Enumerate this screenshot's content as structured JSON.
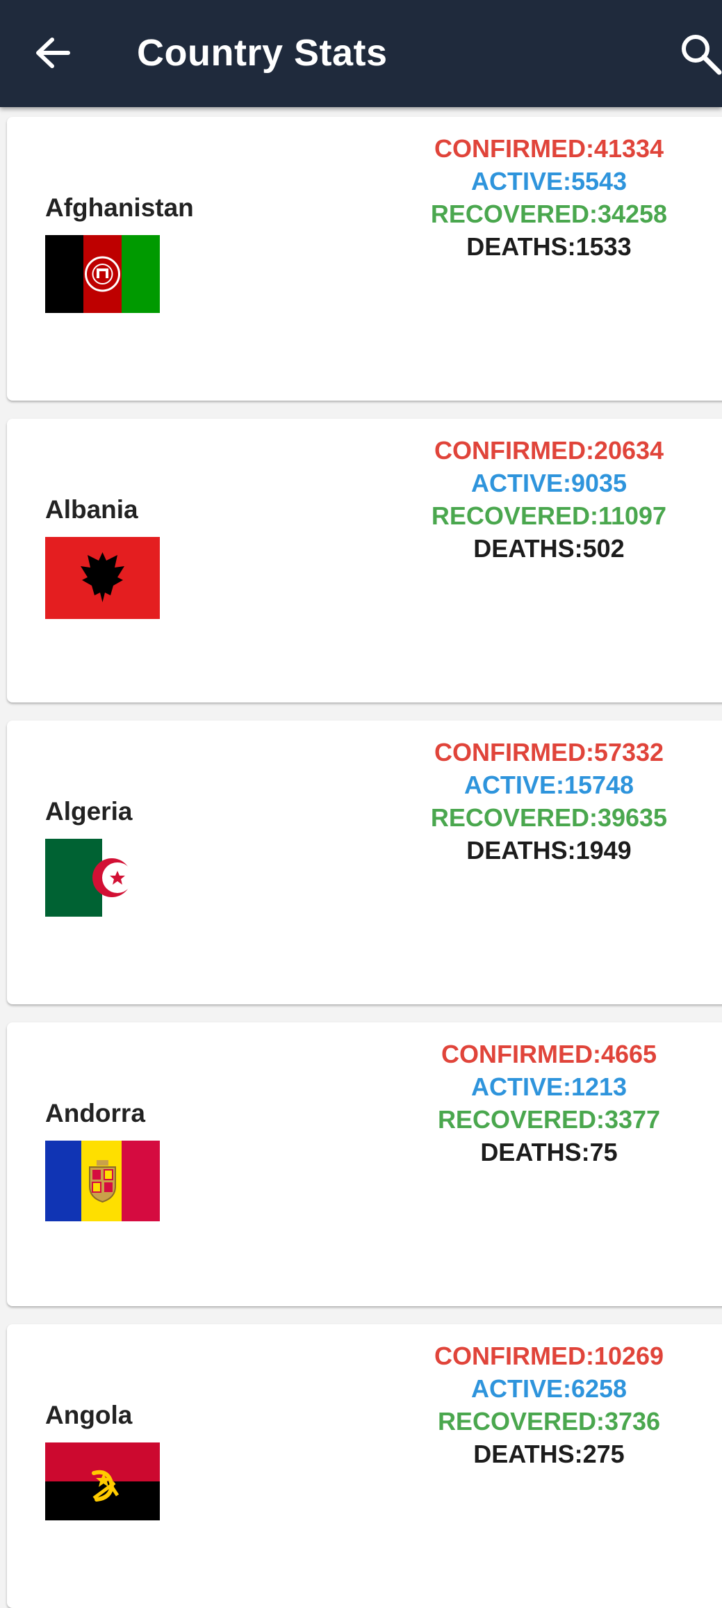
{
  "appbar": {
    "title": "Country Stats",
    "back_icon": "arrow-left-icon",
    "search_icon": "search-icon",
    "background": "#1f2a3c"
  },
  "colors": {
    "confirmed": "#e0443a",
    "active": "#2e94dc",
    "recovered": "#4aa74e",
    "deaths": "#1c1c1c"
  },
  "countries": [
    {
      "name": "Afghanistan",
      "flag": "afghanistan-flag-icon",
      "confirmed": "CONFIRMED:41334",
      "active": "ACTIVE:5543",
      "recovered": "RECOVERED:34258",
      "deaths": "DEATHS:1533"
    },
    {
      "name": "Albania",
      "flag": "albania-flag-icon",
      "confirmed": "CONFIRMED:20634",
      "active": "ACTIVE:9035",
      "recovered": "RECOVERED:11097",
      "deaths": "DEATHS:502"
    },
    {
      "name": "Algeria",
      "flag": "algeria-flag-icon",
      "confirmed": "CONFIRMED:57332",
      "active": "ACTIVE:15748",
      "recovered": "RECOVERED:39635",
      "deaths": "DEATHS:1949"
    },
    {
      "name": "Andorra",
      "flag": "andorra-flag-icon",
      "confirmed": "CONFIRMED:4665",
      "active": "ACTIVE:1213",
      "recovered": "RECOVERED:3377",
      "deaths": "DEATHS:75"
    },
    {
      "name": "Angola",
      "flag": "angola-flag-icon",
      "confirmed": "CONFIRMED:10269",
      "active": "ACTIVE:6258",
      "recovered": "RECOVERED:3736",
      "deaths": "DEATHS:275"
    }
  ]
}
